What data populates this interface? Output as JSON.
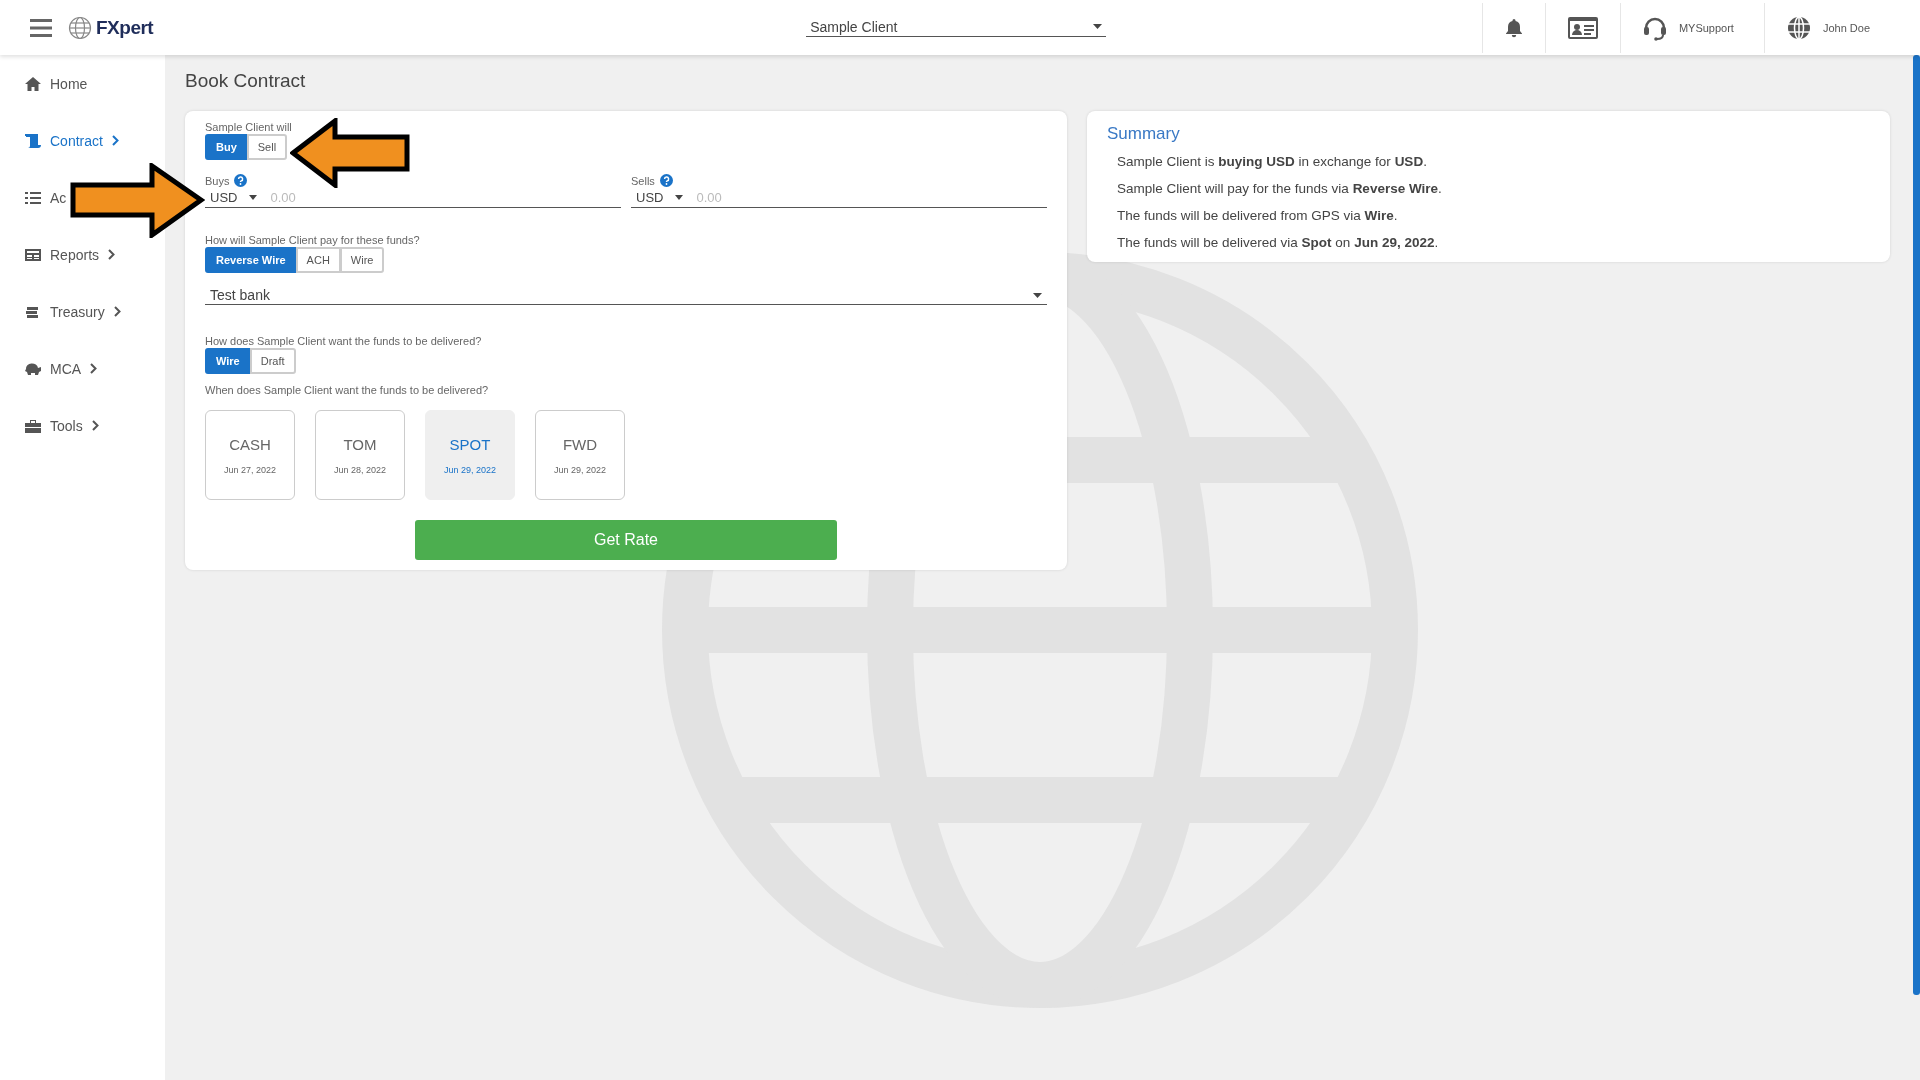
{
  "header": {
    "logo": "FXpert",
    "client_select": "Sample Client",
    "support": "MYSupport",
    "user": "John Doe"
  },
  "sidebar": {
    "items": [
      {
        "label": "Home",
        "selected": false,
        "expandable": false
      },
      {
        "label": "Contract",
        "selected": true,
        "expandable": true
      },
      {
        "label": "Ac",
        "selected": false,
        "expandable": false
      },
      {
        "label": "Reports",
        "selected": false,
        "expandable": true
      },
      {
        "label": "Treasury",
        "selected": false,
        "expandable": true
      },
      {
        "label": "MCA",
        "selected": false,
        "expandable": true
      },
      {
        "label": "Tools",
        "selected": false,
        "expandable": true
      }
    ]
  },
  "page_title": "Book Contract",
  "form": {
    "action_label": "Sample Client will",
    "action_options": [
      {
        "label": "Buy",
        "selected": true
      },
      {
        "label": "Sell",
        "selected": false
      }
    ],
    "amounts": [
      {
        "label": "Buys",
        "currency": "USD",
        "placeholder": "0.00"
      },
      {
        "label": "Sells",
        "currency": "USD",
        "placeholder": "0.00"
      }
    ],
    "payment_question": "How will Sample Client pay for these funds?",
    "payment_options": [
      {
        "label": "Reverse Wire",
        "selected": true
      },
      {
        "label": "ACH",
        "selected": false
      },
      {
        "label": "Wire",
        "selected": false
      }
    ],
    "bank_select": "Test bank",
    "delivery_question": "How does Sample Client want the funds to be delivered?",
    "delivery_options": [
      {
        "label": "Wire",
        "selected": true
      },
      {
        "label": "Draft",
        "selected": false
      }
    ],
    "date_question": "When does Sample Client want the funds to be delivered?",
    "tenors": [
      {
        "name": "CASH",
        "date": "Jun 27, 2022",
        "selected": false
      },
      {
        "name": "TOM",
        "date": "Jun 28, 2022",
        "selected": false
      },
      {
        "name": "SPOT",
        "date": "Jun 29, 2022",
        "selected": true
      },
      {
        "name": "FWD",
        "date": "Jun 29, 2022",
        "selected": false
      }
    ],
    "submit": "Get Rate"
  },
  "summary": {
    "title": "Summary",
    "lines": [
      "Sample Client is **buying USD** in exchange for **USD**.",
      "Sample Client will pay for the funds via **Reverse Wire**.",
      "The funds will be delivered from GPS via **Wire**.",
      "The funds will be delivered via **Spot** on **Jun 29, 2022**."
    ]
  }
}
